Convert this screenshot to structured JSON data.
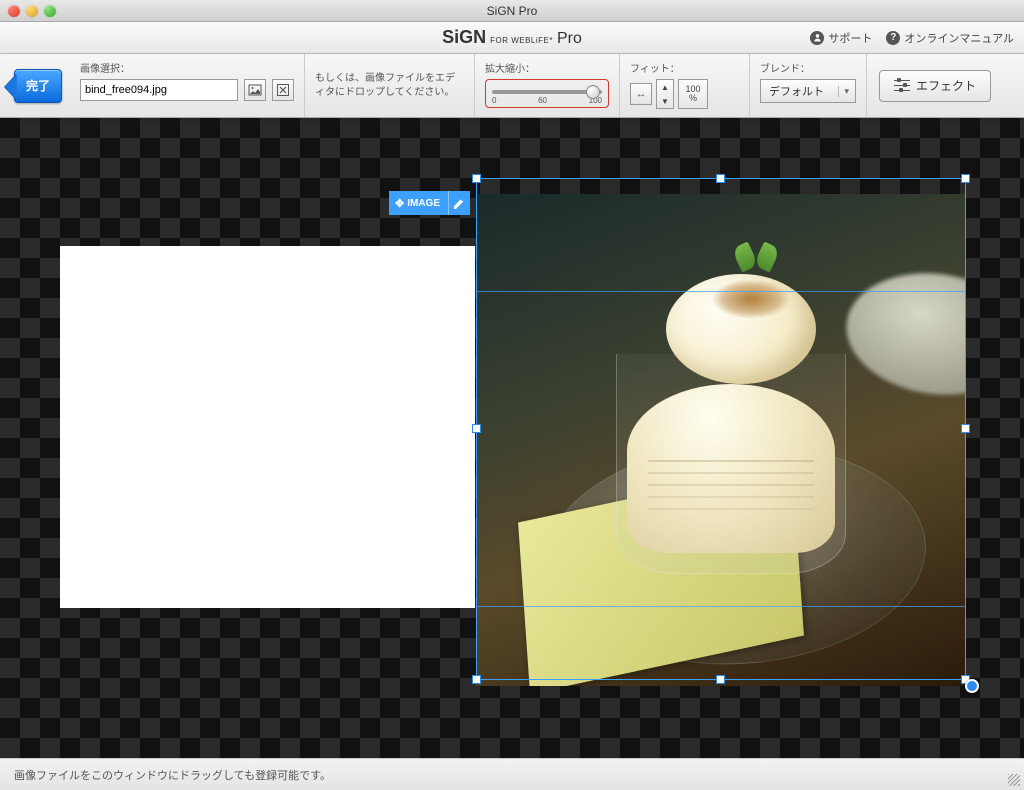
{
  "window": {
    "title": "SiGN Pro"
  },
  "brand": {
    "name": "SiGN",
    "sub": "FOR WEBLiFE*",
    "suffix": "Pro"
  },
  "header_links": {
    "support": "サポート",
    "manual": "オンラインマニュアル"
  },
  "toolbar": {
    "done": "完了",
    "image_select_label": "画像選択：",
    "filename": "bind_free094.jpg",
    "hint": "もしくは、画像ファイルをエディタにドロップしてください。",
    "zoom_label": "拡大縮小：",
    "zoom_min": "0",
    "zoom_mid": "60",
    "zoom_max": "100",
    "fit_label": "フィット：",
    "pct_value": "100",
    "pct_unit": "%",
    "blend_label": "ブレンド：",
    "blend_value": "デフォルト",
    "effect": "エフェクト"
  },
  "selection": {
    "tag": "IMAGE"
  },
  "footer": {
    "hint": "画像ファイルをこのウィンドウにドラッグしても登録可能です。"
  }
}
